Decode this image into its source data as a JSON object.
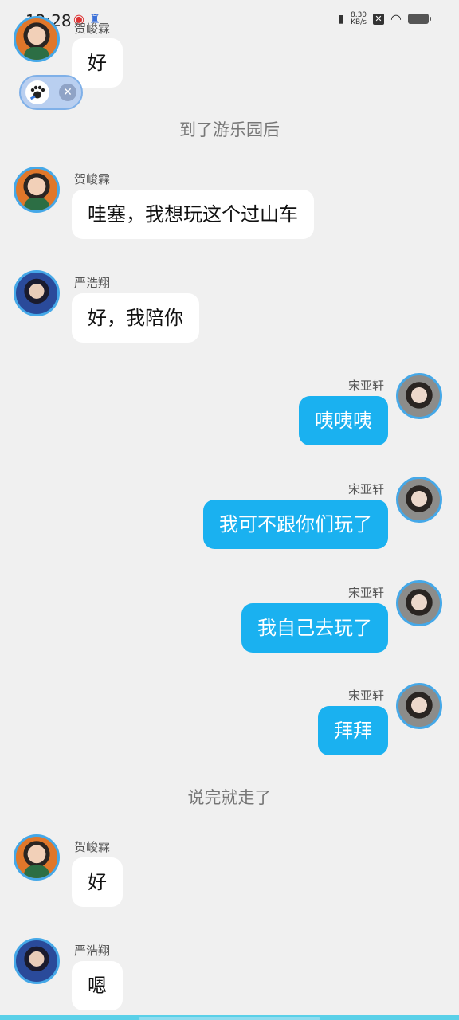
{
  "status_bar": {
    "time": "12:28",
    "net_speed_value": "8.30",
    "net_speed_unit": "KB/s"
  },
  "messages": [
    {
      "type": "left",
      "speaker": "贺峻霖",
      "text": "好",
      "avatar": "he"
    },
    {
      "type": "narration",
      "text": "到了游乐园后"
    },
    {
      "type": "left",
      "speaker": "贺峻霖",
      "text": "哇塞，我想玩这个过山车",
      "avatar": "he"
    },
    {
      "type": "left",
      "speaker": "严浩翔",
      "text": "好，我陪你",
      "avatar": "yan"
    },
    {
      "type": "right",
      "speaker": "宋亚轩",
      "text": "咦咦咦",
      "avatar": "song"
    },
    {
      "type": "right",
      "speaker": "宋亚轩",
      "text": "我可不跟你们玩了",
      "avatar": "song"
    },
    {
      "type": "right",
      "speaker": "宋亚轩",
      "text": "我自己去玩了",
      "avatar": "song"
    },
    {
      "type": "right",
      "speaker": "宋亚轩",
      "text": "拜拜",
      "avatar": "song"
    },
    {
      "type": "narration",
      "text": "说完就走了"
    },
    {
      "type": "left",
      "speaker": "贺峻霖",
      "text": "好",
      "avatar": "he"
    },
    {
      "type": "left",
      "speaker": "严浩翔",
      "text": "嗯",
      "avatar": "yan"
    }
  ],
  "colors": {
    "background": "#f0f0f0",
    "right_bubble": "#1ab1f0",
    "left_bubble": "#ffffff",
    "avatar_ring": "#45a8e8"
  }
}
